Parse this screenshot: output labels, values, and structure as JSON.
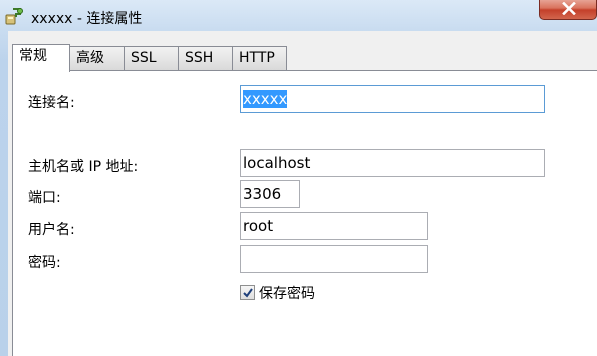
{
  "window": {
    "title": "xxxxx - 连接属性"
  },
  "tabs": [
    {
      "label": "常规",
      "active": true
    },
    {
      "label": "高级",
      "active": false
    },
    {
      "label": "SSL",
      "active": false
    },
    {
      "label": "SSH",
      "active": false
    },
    {
      "label": "HTTP",
      "active": false
    }
  ],
  "form": {
    "connection_name_label": "连接名:",
    "connection_name_value": "xxxxx",
    "host_label": "主机名或 IP 地址:",
    "host_value": "localhost",
    "port_label": "端口:",
    "port_value": "3306",
    "username_label": "用户名:",
    "username_value": "root",
    "password_label": "密码:",
    "password_value": "",
    "save_password_label": "保存密码",
    "save_password_checked": true
  },
  "icons": {
    "app": "navicat-connection-icon",
    "close": "close-icon",
    "check": "checkmark-icon"
  },
  "colors": {
    "selection": "#3399ff",
    "close_button": "#c4402a",
    "focus_border": "#5b9bd5"
  }
}
